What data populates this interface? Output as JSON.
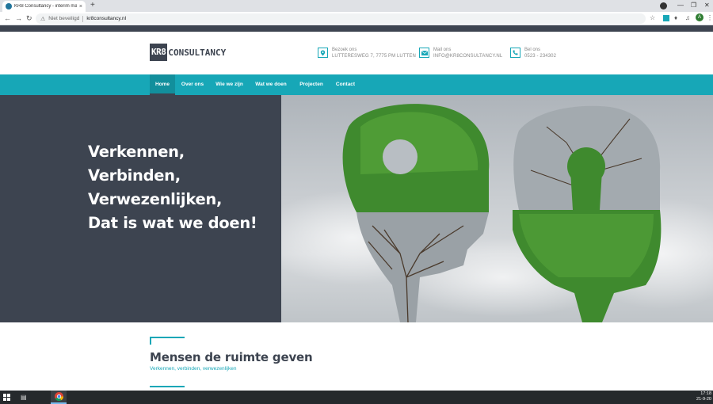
{
  "browser": {
    "tab_title": "KR8 Consultancy - interim mana",
    "tab_close": "×",
    "new_tab": "+",
    "security_label": "Niet beveiligd",
    "url": "kr8consultancy.nl",
    "profile_initial": "A"
  },
  "site": {
    "logo_left": "KR8",
    "logo_right": "CONSULTANCY",
    "contacts": [
      {
        "icon": "map-pin-icon",
        "label": "Bezoek ons",
        "value": "LUTTERESWEG 7, 7775 PM LUTTEN"
      },
      {
        "icon": "mail-icon",
        "label": "Mail ons",
        "value": "INFO@KR8CONSULTANCY.NL"
      },
      {
        "icon": "phone-icon",
        "label": "Bel ons",
        "value": "0523 - 234302"
      }
    ],
    "nav": [
      "Home",
      "Over ons",
      "Wie we zijn",
      "Wat we doen",
      "Projecten",
      "Contact"
    ],
    "nav_active": "Home",
    "hero_lines": [
      "Verkennen,",
      "Verbinden,",
      "Verwezenlijken,",
      "Dat is wat we doen!"
    ],
    "section_title": "Mensen de ruimte geven",
    "section_subtitle": "Verkennen, verbinden, verwezenlijken"
  },
  "taskbar": {
    "time": "17:18",
    "date": "21-9-20"
  },
  "colors": {
    "accent": "#17a7b7",
    "dark": "#3d4450"
  }
}
